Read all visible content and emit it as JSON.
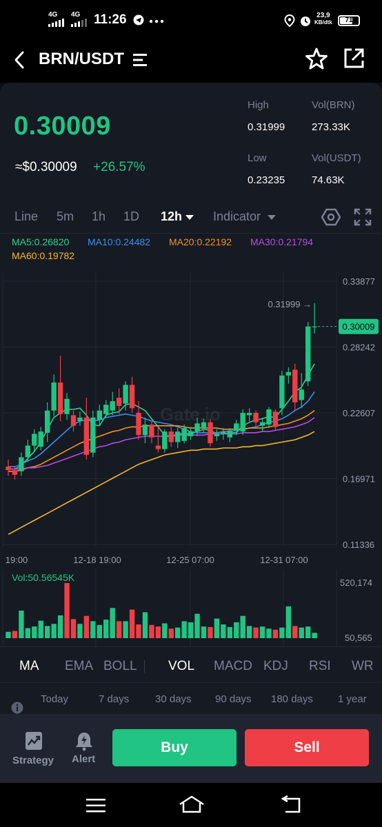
{
  "status_bar": {
    "signal_1": "4G",
    "signal_2": "4G",
    "time": "11:26",
    "net_speed_value": "23,9",
    "net_speed_unit": "KB/dtk",
    "battery": "71",
    "battery_level": 0.71
  },
  "header": {
    "pair": "BRN/USDT",
    "icons": [
      "back-icon",
      "menu-list-icon",
      "star-icon",
      "share-icon"
    ]
  },
  "ticker": {
    "last_price": "0.30009",
    "fiat_price": "≈$0.30009",
    "change": "+26.57%",
    "high_label": "High",
    "high_value": "0.31999",
    "vol_brn_label": "Vol(BRN)",
    "vol_brn_value": "273.33K",
    "low_label": "Low",
    "low_value": "0.23235",
    "vol_usdt_label": "Vol(USDT)",
    "vol_usdt_value": "74.63K"
  },
  "timeframes": {
    "items": [
      "Line",
      "5m",
      "1h",
      "1D"
    ],
    "active": "12h",
    "indicator": "Indicator"
  },
  "ma_legend": {
    "ma5": "MA5:0.26820",
    "ma10": "MA10:0.24482",
    "ma20": "MA20:0.22192",
    "ma30": "MA30:0.21794",
    "ma60": "MA60:0.19782"
  },
  "colors": {
    "up": "#21c483",
    "down": "#ef3e46",
    "ma5": "#2fd08f",
    "ma10": "#3c8df0",
    "ma20": "#f5932c",
    "ma30": "#b84de6",
    "ma60": "#f5b92c"
  },
  "chart_data": {
    "type": "candlestick",
    "y_axis_labels": [
      "0.33877",
      "0.28242",
      "0.22607",
      "0.16971",
      "0.11336"
    ],
    "ylim": [
      0.11336,
      0.33877
    ],
    "x_axis_labels": [
      "19:00",
      "12-18 19:00",
      "12-25 07:00",
      "12-31 07:00"
    ],
    "last_price_tag": "0.30009",
    "high_annotation": "0.31999 →",
    "watermark": "Gate.io",
    "candles": [
      [
        0.18,
        0.186,
        0.172,
        0.177
      ],
      [
        0.177,
        0.18,
        0.169,
        0.173
      ],
      [
        0.176,
        0.192,
        0.172,
        0.188
      ],
      [
        0.188,
        0.203,
        0.184,
        0.198
      ],
      [
        0.198,
        0.212,
        0.193,
        0.208
      ],
      [
        0.197,
        0.214,
        0.194,
        0.21
      ],
      [
        0.209,
        0.235,
        0.201,
        0.228
      ],
      [
        0.228,
        0.259,
        0.223,
        0.252
      ],
      [
        0.252,
        0.275,
        0.219,
        0.225
      ],
      [
        0.225,
        0.243,
        0.22,
        0.238
      ],
      [
        0.224,
        0.228,
        0.21,
        0.215
      ],
      [
        0.219,
        0.227,
        0.215,
        0.222
      ],
      [
        0.222,
        0.239,
        0.186,
        0.19
      ],
      [
        0.192,
        0.228,
        0.188,
        0.222
      ],
      [
        0.22,
        0.233,
        0.215,
        0.228
      ],
      [
        0.225,
        0.237,
        0.222,
        0.233
      ],
      [
        0.228,
        0.244,
        0.224,
        0.236
      ],
      [
        0.239,
        0.247,
        0.225,
        0.232
      ],
      [
        0.234,
        0.253,
        0.228,
        0.25
      ],
      [
        0.25,
        0.257,
        0.226,
        0.23
      ],
      [
        0.226,
        0.236,
        0.203,
        0.207
      ],
      [
        0.207,
        0.222,
        0.2,
        0.216
      ],
      [
        0.216,
        0.219,
        0.2,
        0.205
      ],
      [
        0.198,
        0.214,
        0.192,
        0.195
      ],
      [
        0.195,
        0.212,
        0.192,
        0.21
      ],
      [
        0.21,
        0.214,
        0.197,
        0.201
      ],
      [
        0.201,
        0.213,
        0.196,
        0.21
      ],
      [
        0.202,
        0.216,
        0.2,
        0.213
      ],
      [
        0.206,
        0.214,
        0.203,
        0.21
      ],
      [
        0.21,
        0.222,
        0.206,
        0.217
      ],
      [
        0.213,
        0.221,
        0.209,
        0.218
      ],
      [
        0.218,
        0.221,
        0.197,
        0.2
      ],
      [
        0.206,
        0.212,
        0.202,
        0.208
      ],
      [
        0.208,
        0.213,
        0.203,
        0.21
      ],
      [
        0.205,
        0.213,
        0.201,
        0.211
      ],
      [
        0.211,
        0.22,
        0.207,
        0.217
      ],
      [
        0.21,
        0.229,
        0.207,
        0.226
      ],
      [
        0.224,
        0.23,
        0.219,
        0.226
      ],
      [
        0.226,
        0.228,
        0.214,
        0.218
      ],
      [
        0.215,
        0.222,
        0.21,
        0.218
      ],
      [
        0.216,
        0.231,
        0.213,
        0.229
      ],
      [
        0.227,
        0.229,
        0.211,
        0.214
      ],
      [
        0.23,
        0.262,
        0.224,
        0.258
      ],
      [
        0.258,
        0.265,
        0.251,
        0.261
      ],
      [
        0.263,
        0.268,
        0.228,
        0.235
      ],
      [
        0.237,
        0.26,
        0.23,
        0.246
      ],
      [
        0.253,
        0.304,
        0.249,
        0.3
      ],
      [
        0.3,
        0.32,
        0.294,
        0.3
      ]
    ],
    "ma_series": [
      {
        "name": "MA5",
        "values": [
          0.178,
          0.178,
          0.181,
          0.187,
          0.193,
          0.201,
          0.212,
          0.222,
          0.226,
          0.229,
          0.229,
          0.23,
          0.224,
          0.216,
          0.215,
          0.224,
          0.226,
          0.227,
          0.233,
          0.234,
          0.231,
          0.228,
          0.221,
          0.214,
          0.207,
          0.205,
          0.208,
          0.208,
          0.208,
          0.21,
          0.212,
          0.211,
          0.208,
          0.208,
          0.209,
          0.209,
          0.215,
          0.218,
          0.22,
          0.221,
          0.223,
          0.222,
          0.229,
          0.236,
          0.244,
          0.248,
          0.258,
          0.268
        ]
      },
      {
        "name": "MA10",
        "values": [
          0.18,
          0.18,
          0.182,
          0.185,
          0.187,
          0.191,
          0.196,
          0.201,
          0.206,
          0.211,
          0.216,
          0.219,
          0.22,
          0.219,
          0.22,
          0.222,
          0.223,
          0.224,
          0.225,
          0.224,
          0.223,
          0.221,
          0.219,
          0.218,
          0.217,
          0.216,
          0.214,
          0.212,
          0.21,
          0.209,
          0.209,
          0.209,
          0.209,
          0.21,
          0.21,
          0.211,
          0.212,
          0.213,
          0.214,
          0.216,
          0.218,
          0.219,
          0.221,
          0.224,
          0.228,
          0.231,
          0.236,
          0.244
        ]
      },
      {
        "name": "MA20",
        "values": [
          0.176,
          0.176,
          0.177,
          0.179,
          0.18,
          0.182,
          0.185,
          0.188,
          0.191,
          0.194,
          0.197,
          0.2,
          0.202,
          0.204,
          0.206,
          0.208,
          0.21,
          0.211,
          0.213,
          0.214,
          0.214,
          0.215,
          0.215,
          0.215,
          0.215,
          0.215,
          0.215,
          0.214,
          0.213,
          0.213,
          0.213,
          0.213,
          0.213,
          0.212,
          0.212,
          0.212,
          0.212,
          0.213,
          0.213,
          0.213,
          0.214,
          0.215,
          0.216,
          0.217,
          0.219,
          0.221,
          0.224,
          0.228
        ]
      },
      {
        "name": "MA30",
        "values": [
          0.178,
          0.178,
          0.178,
          0.179,
          0.179,
          0.18,
          0.181,
          0.183,
          0.185,
          0.187,
          0.189,
          0.191,
          0.193,
          0.195,
          0.197,
          0.198,
          0.2,
          0.201,
          0.203,
          0.204,
          0.205,
          0.206,
          0.206,
          0.206,
          0.206,
          0.207,
          0.207,
          0.207,
          0.207,
          0.207,
          0.207,
          0.208,
          0.208,
          0.208,
          0.208,
          0.208,
          0.209,
          0.209,
          0.209,
          0.21,
          0.21,
          0.211,
          0.212,
          0.213,
          0.214,
          0.216,
          0.218,
          0.222
        ]
      },
      {
        "name": "MA60",
        "values": [
          0.122,
          0.125,
          0.128,
          0.131,
          0.134,
          0.137,
          0.14,
          0.143,
          0.146,
          0.149,
          0.152,
          0.155,
          0.158,
          0.161,
          0.164,
          0.167,
          0.17,
          0.173,
          0.176,
          0.179,
          0.182,
          0.184,
          0.186,
          0.188,
          0.19,
          0.191,
          0.192,
          0.193,
          0.194,
          0.194,
          0.195,
          0.195,
          0.195,
          0.196,
          0.196,
          0.196,
          0.197,
          0.197,
          0.198,
          0.198,
          0.199,
          0.2,
          0.201,
          0.202,
          0.203,
          0.205,
          0.207,
          0.21
        ]
      }
    ],
    "volume": {
      "label": "Vol:50.56545K",
      "axis_max_label": "520,174",
      "axis_min_label": "50,565",
      "range": [
        50565,
        520174
      ],
      "values": [
        60000,
        68000,
        260000,
        95000,
        110000,
        165000,
        115000,
        135000,
        215000,
        520000,
        180000,
        135000,
        210000,
        160000,
        125000,
        175000,
        285000,
        160000,
        160000,
        270000,
        130000,
        245000,
        125000,
        110000,
        140000,
        90000,
        100000,
        160000,
        150000,
        230000,
        110000,
        105000,
        185000,
        130000,
        105000,
        150000,
        210000,
        115000,
        100000,
        110000,
        90000,
        80000,
        100000,
        300000,
        115000,
        100000,
        110000,
        50565
      ],
      "up": [
        true,
        false,
        true,
        true,
        true,
        true,
        true,
        true,
        true,
        false,
        false,
        true,
        false,
        true,
        true,
        true,
        true,
        false,
        true,
        false,
        false,
        true,
        false,
        false,
        true,
        false,
        true,
        true,
        true,
        true,
        true,
        false,
        true,
        true,
        true,
        true,
        true,
        true,
        false,
        true,
        true,
        false,
        true,
        true,
        false,
        true,
        true,
        true
      ]
    }
  },
  "indicator_tabs": {
    "main": [
      "MA",
      "EMA",
      "BOLL"
    ],
    "sub": [
      "VOL",
      "MACD",
      "KDJ",
      "RSI",
      "WR"
    ]
  },
  "periods": [
    "Today",
    "7 days",
    "30 days",
    "90 days",
    "180 days",
    "1 year"
  ],
  "actions": {
    "strategy": "Strategy",
    "alert": "Alert",
    "buy": "Buy",
    "sell": "Sell"
  }
}
